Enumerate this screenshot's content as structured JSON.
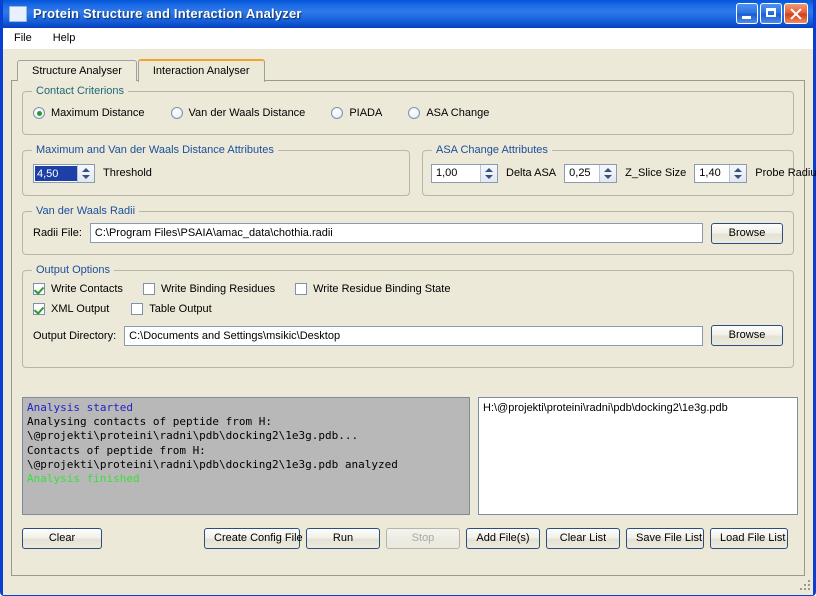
{
  "window": {
    "title": "Protein Structure and Interaction Analyzer",
    "icon": "app-window-icon",
    "minimize_label": "",
    "maximize_label": "",
    "close_label": ""
  },
  "menubar": {
    "items": [
      {
        "label": "File"
      },
      {
        "label": "Help"
      }
    ]
  },
  "tabs": [
    {
      "label": "Structure Analyser",
      "active": false
    },
    {
      "label": "Interaction Analyser",
      "active": true
    }
  ],
  "contact_criterions": {
    "title": "Contact Criterions",
    "options": [
      {
        "label": "Maximum Distance",
        "selected": true
      },
      {
        "label": "Van der Waals Distance",
        "selected": false
      },
      {
        "label": "PIADA",
        "selected": false
      },
      {
        "label": "ASA Change",
        "selected": false
      }
    ]
  },
  "distance_attributes": {
    "title": "Maximum and Van der Waals Distance Attributes",
    "threshold": {
      "value": "4,50",
      "label": "Threshold",
      "selected": true
    }
  },
  "asa_attributes": {
    "title": "ASA Change Attributes",
    "fields": [
      {
        "value": "1,00",
        "label": "Delta ASA"
      },
      {
        "value": "0,25",
        "label": "Z_Slice Size"
      },
      {
        "value": "1,40",
        "label": "Probe Radius"
      }
    ]
  },
  "radii": {
    "title": "Van der Waals Radii",
    "file_label": "Radii File:",
    "file_value": "C:\\Program Files\\PSAIA\\amac_data\\chothia.radii",
    "browse_label": "Browse"
  },
  "output_options": {
    "title": "Output Options",
    "checkboxes_row1": [
      {
        "label": "Write Contacts",
        "checked": true
      },
      {
        "label": "Write Binding Residues",
        "checked": false
      },
      {
        "label": "Write Residue Binding State",
        "checked": false
      }
    ],
    "checkboxes_row2": [
      {
        "label": "XML Output",
        "checked": true
      },
      {
        "label": "Table Output",
        "checked": false
      }
    ],
    "directory_label": "Output Directory:",
    "directory_value": "C:\\Documents and Settings\\msikic\\Desktop",
    "browse_label": "Browse"
  },
  "log": {
    "lines": [
      {
        "text": "Analysis started",
        "color": "blue"
      },
      {
        "text": "Analysing contacts of peptide from H:",
        "color": "black"
      },
      {
        "text": "\\@projekti\\proteini\\radni\\pdb\\docking2\\1e3g.pdb...",
        "color": "black"
      },
      {
        "text": "Contacts of peptide from H:",
        "color": "black"
      },
      {
        "text": "\\@projekti\\proteini\\radni\\pdb\\docking2\\1e3g.pdb analyzed",
        "color": "black"
      },
      {
        "text": "Analysis finished",
        "color": "green"
      }
    ]
  },
  "file_list": {
    "items": [
      {
        "path": "H:\\@projekti\\proteini\\radni\\pdb\\docking2\\1e3g.pdb"
      }
    ]
  },
  "buttons": {
    "clear": "Clear",
    "create_config_file": "Create Config File",
    "run": "Run",
    "stop": "Stop",
    "stop_disabled": true,
    "add_files": "Add File(s)",
    "clear_list": "Clear List",
    "save_file_list": "Save File List",
    "load_file_list": "Load File List"
  },
  "colors": {
    "title_bar": "#0a5bdd",
    "client_bg": "#ece9d8",
    "group_title": "#1b4f9c",
    "group_title_teal": "#1b6b7a",
    "active_tab_accent": "#f0a42a",
    "check_green": "#2e9a2e",
    "selection_blue": "#1d3fa8",
    "log_bg": "#b8b8b8",
    "log_started": "#2222cc",
    "log_finished": "#3ae03a"
  }
}
